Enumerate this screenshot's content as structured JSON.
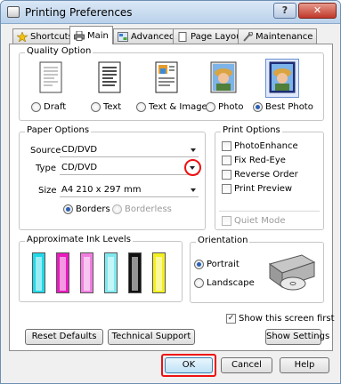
{
  "window": {
    "title": "Printing Preferences",
    "help_label": "?",
    "close_label": "✕"
  },
  "tabs": [
    {
      "label": "Shortcuts",
      "icon": "star-icon"
    },
    {
      "label": "Main",
      "icon": "printer-icon"
    },
    {
      "label": "Advanced",
      "icon": "advanced-icon"
    },
    {
      "label": "Page Layout",
      "icon": "page-icon"
    },
    {
      "label": "Maintenance",
      "icon": "wrench-icon"
    }
  ],
  "quality": {
    "group_label": "Quality Option",
    "options": [
      "Draft",
      "Text",
      "Text & Image",
      "Photo",
      "Best Photo"
    ],
    "selected": "Best Photo"
  },
  "paper": {
    "group_label": "Paper Options",
    "source_label": "Source",
    "source_value": "CD/DVD",
    "type_label": "Type",
    "type_value": "CD/DVD",
    "size_label": "Size",
    "size_value": "A4 210 x 297 mm",
    "borders_label": "Borders",
    "borderless_label": "Borderless"
  },
  "print_options": {
    "group_label": "Print Options",
    "items": [
      "PhotoEnhance",
      "Fix Red-Eye",
      "Reverse Order",
      "Print Preview"
    ],
    "quiet_mode": "Quiet Mode"
  },
  "ink": {
    "group_label": "Approximate Ink Levels",
    "cartridges": [
      {
        "color": "#22d8e8",
        "level": 1.0
      },
      {
        "color": "#e81bbe",
        "level": 1.0
      },
      {
        "color": "#f07ee0",
        "level": 1.0
      },
      {
        "color": "#7fe8ee",
        "level": 1.0
      },
      {
        "color": "#111111",
        "level": 1.0
      },
      {
        "color": "#f4f020",
        "level": 1.0
      }
    ]
  },
  "orientation": {
    "group_label": "Orientation",
    "portrait": "Portrait",
    "landscape": "Landscape",
    "selected": "Portrait"
  },
  "show_first": {
    "label": "Show this screen first",
    "checked": true
  },
  "buttons": {
    "reset": "Reset Defaults",
    "support": "Technical Support",
    "show_settings": "Show Settings",
    "ok": "OK",
    "cancel": "Cancel",
    "help": "Help"
  },
  "colors": {
    "highlight": "#e11111",
    "accent": "#2a5fb6"
  }
}
